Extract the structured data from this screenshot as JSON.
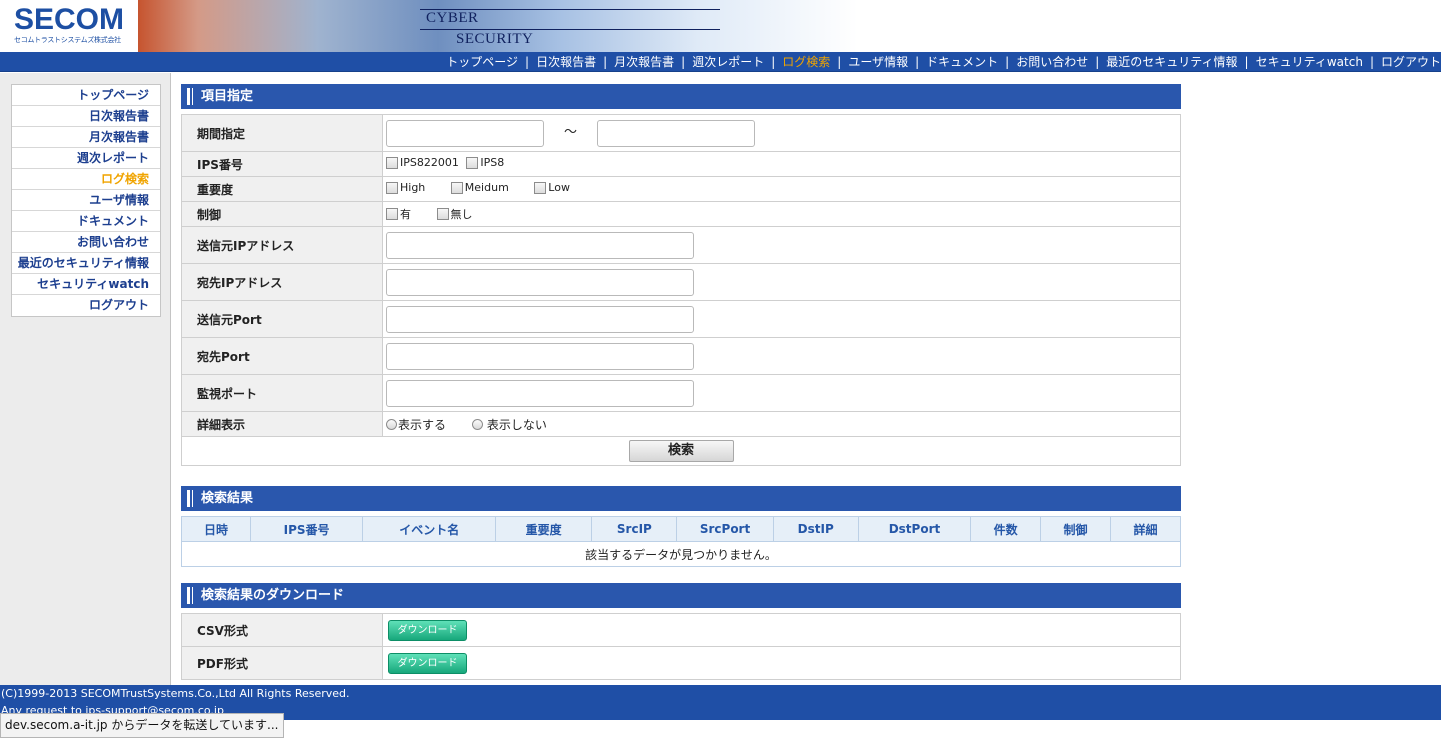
{
  "header": {
    "logo_word": "SECOM",
    "logo_sub": "セコムトラストシステムズ株式会社",
    "tag_line1": "CYBER",
    "tag_line2": "SECURITY"
  },
  "topnav": {
    "items": [
      {
        "label": "トップページ"
      },
      {
        "label": "日次報告書"
      },
      {
        "label": "月次報告書"
      },
      {
        "label": "週次レポート"
      },
      {
        "label": "ログ検索",
        "active": true
      },
      {
        "label": "ユーザ情報"
      },
      {
        "label": "ドキュメント"
      },
      {
        "label": "お問い合わせ"
      },
      {
        "label": "最近のセキュリティ情報"
      },
      {
        "label": "セキュリティwatch"
      },
      {
        "label": "ログアウト"
      }
    ],
    "separator": "|"
  },
  "sidemenu": {
    "items": [
      {
        "label": "トップページ"
      },
      {
        "label": "日次報告書"
      },
      {
        "label": "月次報告書"
      },
      {
        "label": "週次レポート"
      },
      {
        "label": "ログ検索",
        "active": true
      },
      {
        "label": "ユーザ情報"
      },
      {
        "label": "ドキュメント"
      },
      {
        "label": "お問い合わせ"
      },
      {
        "label": "最近のセキュリティ情報"
      },
      {
        "label": "セキュリティwatch"
      },
      {
        "label": "ログアウト"
      }
    ]
  },
  "form": {
    "title": "項目指定",
    "period_label": "期間指定",
    "period_sep": "～",
    "ips_label": "IPS番号",
    "ips_options": [
      "IPS822001",
      "IPS8"
    ],
    "severity_label": "重要度",
    "severity_options": [
      "High",
      "Meidum",
      "Low"
    ],
    "control_label": "制御",
    "control_options": [
      "有",
      "無し"
    ],
    "src_ip_label": "送信元IPアドレス",
    "dst_ip_label": "宛先IPアドレス",
    "src_port_label": "送信元Port",
    "dst_port_label": "宛先Port",
    "monitor_port_label": "監視ポート",
    "detail_label": "詳細表示",
    "detail_options": [
      "表示する",
      "表示しない"
    ],
    "search_button": "検索"
  },
  "results": {
    "title": "検索結果",
    "columns": [
      "日時",
      "IPS番号",
      "イベント名",
      "重要度",
      "SrcIP",
      "SrcPort",
      "DstIP",
      "DstPort",
      "件数",
      "制御",
      "詳細"
    ],
    "empty_message": "該当するデータが見つかりません。"
  },
  "download": {
    "title": "検索結果のダウンロード",
    "csv_label": "CSV形式",
    "pdf_label": "PDF形式",
    "button_label": "ダウンロード"
  },
  "footer": {
    "copyright": "(C)1999-2013 SECOMTrustSystems.Co.,Ltd All Rights Reserved.",
    "request": "Any request to ips-support@secom.co.jp"
  },
  "statusbar": {
    "text": "dev.secom.a-it.jp からデータを転送しています..."
  },
  "colors": {
    "nav_blue": "#1f4fa6",
    "section_blue": "#2a57ad",
    "active_orange": "#f0a400",
    "menu_text": "#1d3f8f",
    "download_green": "#17a77b"
  }
}
